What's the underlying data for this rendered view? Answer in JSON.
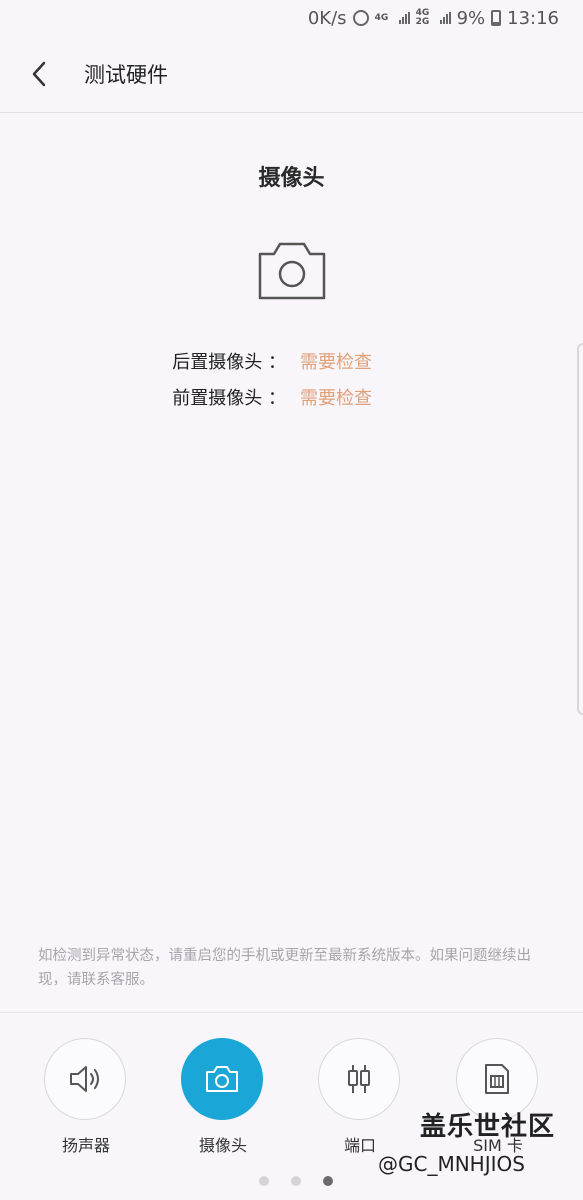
{
  "status_bar": {
    "speed": "0K/s",
    "net1": "4G",
    "net2": "4G 2G",
    "battery": "9%",
    "time": "13:16"
  },
  "app_bar": {
    "title": "测试硬件"
  },
  "section": {
    "title": "摄像头",
    "rows": [
      {
        "label": "后置摄像头 ：",
        "value": "需要检查"
      },
      {
        "label": "前置摄像头 ：",
        "value": "需要检查"
      }
    ]
  },
  "note": "如检测到异常状态，请重启您的手机或更新至最新系统版本。如果问题继续出现，请联系客服。",
  "tabs": [
    {
      "label": "扬声器",
      "icon": "speaker-icon"
    },
    {
      "label": "摄像头",
      "icon": "camera-icon",
      "active": true
    },
    {
      "label": "端口",
      "icon": "port-icon"
    },
    {
      "label": "SIM 卡",
      "icon": "sim-card-icon"
    }
  ],
  "pager": {
    "page": 3,
    "total": 3
  },
  "watermark": {
    "line1": "盖乐世社区",
    "line2": "@GC_MNHJIOS"
  },
  "colors": {
    "accent": "#1aa7d8",
    "warning_text": "#e0a07a",
    "background": "#f8f6fb"
  }
}
